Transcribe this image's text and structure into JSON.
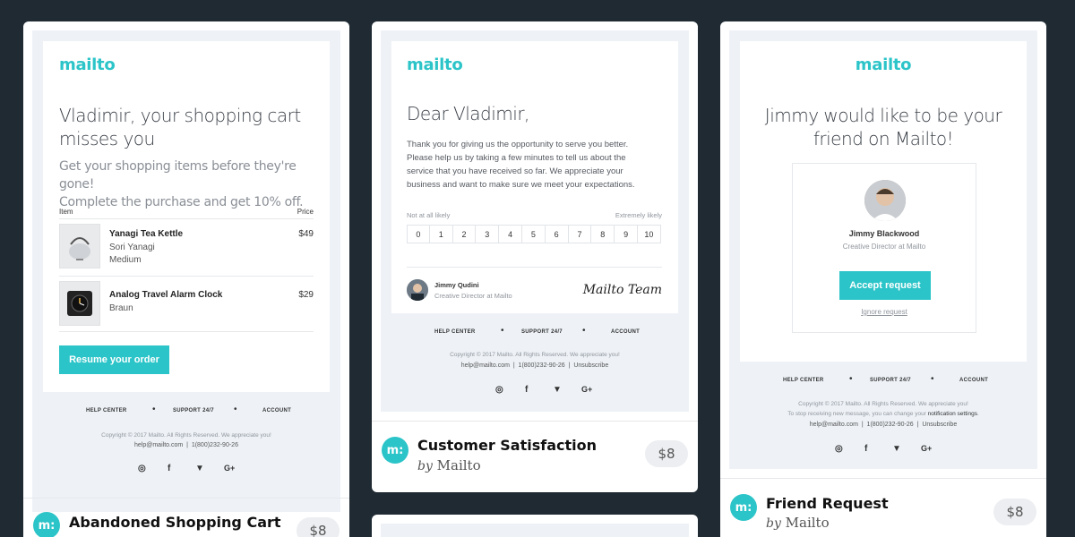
{
  "cards": {
    "cart": {
      "logo": "mailto",
      "headline_1": "Vladimir, your shopping cart",
      "headline_2": "misses you",
      "sub_1": "Get your shopping items before they're gone!",
      "sub_2": "Complete the purchase and get 10% off.",
      "col_item": "Item",
      "col_price": "Price",
      "items": [
        {
          "name": "Yanagi Tea Kettle",
          "line2": "Sori Yanagi",
          "line3": "Medium",
          "price": "$49"
        },
        {
          "name": "Analog Travel Alarm Clock",
          "line2": "Braun",
          "price": "$29"
        }
      ],
      "cta": "Resume your order",
      "footer_links": [
        "HELP CENTER",
        "SUPPORT 24/7",
        "ACCOUNT"
      ],
      "copyright": "Copyright © 2017 Mailto. All Rights Reserved. We appreciate you!",
      "contact_email": "help@mailto.com",
      "contact_phone": "1(800)232-90-26",
      "title": "Abandoned Shopping Cart",
      "badge": "m:",
      "price": "$8"
    },
    "satisfaction": {
      "logo": "mailto",
      "headline": "Dear Vladimir,",
      "body": [
        "Thank you for giving us the opportunity to serve you better.",
        "Please help us by taking a few minutes to tell us about the",
        "service that you have received so far. We appreciate your",
        "business and want to make sure we meet your expectations."
      ],
      "scale_low": "Not at all likely",
      "scale_high": "Extremely likely",
      "scale": [
        "0",
        "1",
        "2",
        "3",
        "4",
        "5",
        "6",
        "7",
        "8",
        "9",
        "10"
      ],
      "sender_name": "Jimmy Qudini",
      "sender_role": "Creative Director at Mailto",
      "signature": "Mailto Team",
      "footer_links": [
        "HELP CENTER",
        "SUPPORT 24/7",
        "ACCOUNT"
      ],
      "copyright": "Copyright © 2017 Mailto. All Rights Reserved. We appreciate you!",
      "contact_email": "help@mailto.com",
      "contact_phone": "1(800)232-90-26",
      "unsubscribe": "Unsubscribe",
      "title": "Customer Satisfaction",
      "by": "by",
      "author": "Mailto",
      "badge": "m:",
      "price": "$8"
    },
    "friend": {
      "logo": "mailto",
      "headline_1": "Jimmy would like to be your",
      "headline_2": "friend on Mailto!",
      "person_name": "Jimmy Blackwood",
      "person_role": "Creative Director at Mailto",
      "accept": "Accept request",
      "ignore": "Ignore request",
      "footer_links": [
        "HELP CENTER",
        "SUPPORT 24/7",
        "ACCOUNT"
      ],
      "copyright": "Copyright © 2017 Mailto. All Rights Reserved. We appreciate you!",
      "stop_text": "To stop receiving new message, you can change your",
      "notif_link": "notification settings",
      "contact_email": "help@mailto.com",
      "contact_phone": "1(800)232-90-26",
      "unsubscribe": "Unsubscribe",
      "title": "Friend Request",
      "by": "by",
      "author": "Mailto",
      "badge": "m:",
      "price": "$8"
    }
  },
  "social_icons": [
    "instagram-icon",
    "facebook-icon",
    "twitter-icon",
    "google-plus-icon"
  ],
  "social_glyphs": [
    "◎",
    "f",
    "🐦",
    "G+"
  ],
  "colors": {
    "accent": "#2bc4c8",
    "background": "#1f2a33",
    "frame": "#eef2f7"
  }
}
